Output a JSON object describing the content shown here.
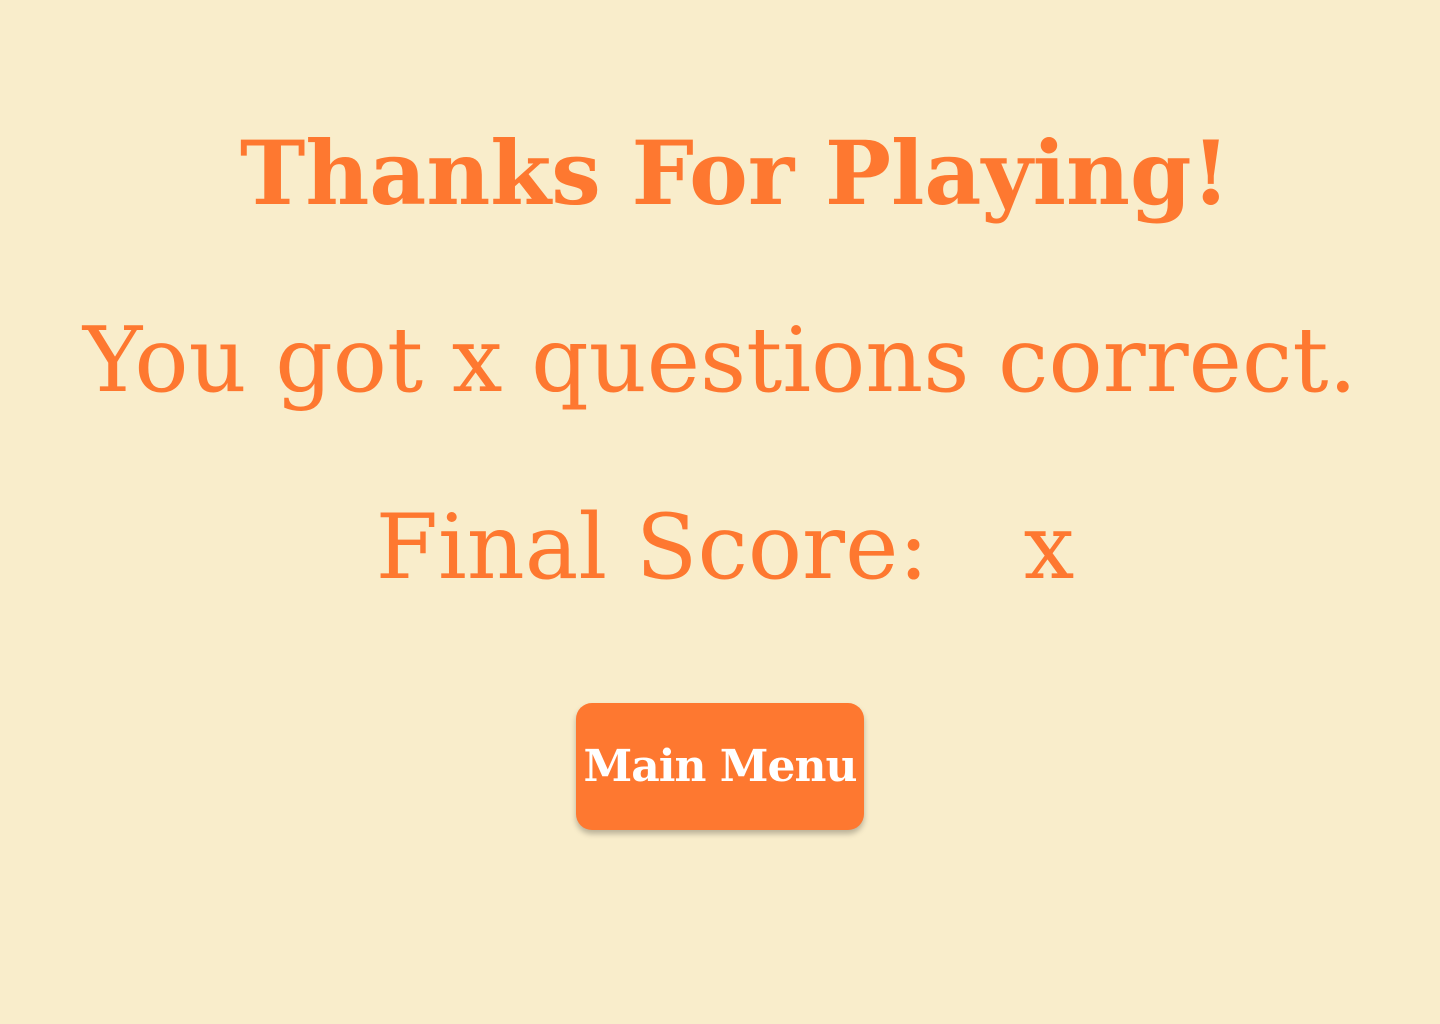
{
  "end_screen": {
    "title": "Thanks For Playing!",
    "summary": "You got x questions correct.",
    "score_label": "Final Score:",
    "score_value": "x"
  },
  "buttons": {
    "main_menu_label": "Main Menu"
  },
  "colors": {
    "background": "#f9edcb",
    "accent": "#fe7830",
    "button_text": "#ffffff"
  }
}
